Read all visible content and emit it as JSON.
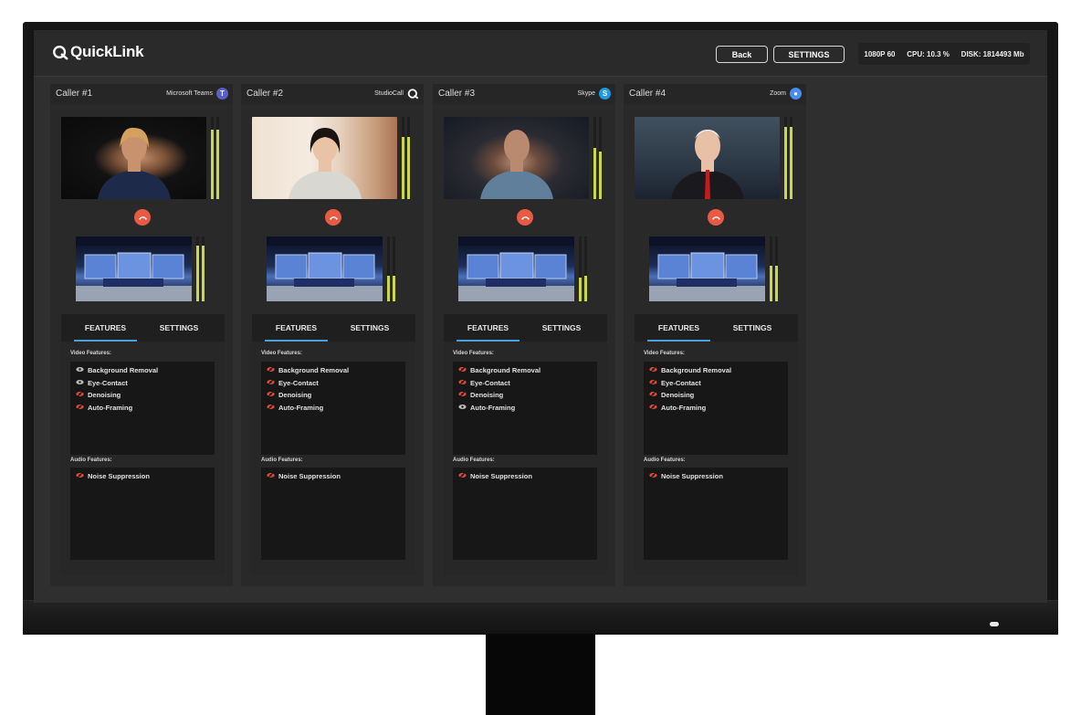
{
  "app": {
    "logo_text": "QuickLink",
    "back_label": "Back",
    "settings_label": "SETTINGS",
    "status": {
      "resolution": "1080P 60",
      "cpu": "CPU: 10.3 %",
      "disk": "DISK: 1814493 Mb"
    }
  },
  "callers": [
    {
      "title": "Caller #1",
      "platform": "Microsoft Teams",
      "platform_icon": "teams-icon",
      "platform_color": "#5b5fc7",
      "tabs": [
        "FEATURES",
        "SETTINGS"
      ],
      "video_label": "Video Features:",
      "audio_label": "Audio Features:",
      "video_features": [
        {
          "label": "Background Removal",
          "state": "on"
        },
        {
          "label": "Eye-Contact",
          "state": "on"
        },
        {
          "label": "Denoising",
          "state": "off"
        },
        {
          "label": "Auto-Framing",
          "state": "off"
        }
      ],
      "audio_features": [
        {
          "label": "Noise Suppression",
          "state": "off"
        }
      ]
    },
    {
      "title": "Caller #2",
      "platform": "StudioCall",
      "platform_icon": "studiocall-icon",
      "platform_color": "#ffffff",
      "tabs": [
        "FEATURES",
        "SETTINGS"
      ],
      "video_label": "Video Features:",
      "audio_label": "Audio Features:",
      "video_features": [
        {
          "label": "Background Removal",
          "state": "off"
        },
        {
          "label": "Eye-Contact",
          "state": "off"
        },
        {
          "label": "Denoising",
          "state": "off"
        },
        {
          "label": "Auto-Framing",
          "state": "off"
        }
      ],
      "audio_features": [
        {
          "label": "Noise Suppression",
          "state": "off"
        }
      ]
    },
    {
      "title": "Caller #3",
      "platform": "Skype",
      "platform_icon": "skype-icon",
      "platform_color": "#1e9be0",
      "tabs": [
        "FEATURES",
        "SETTINGS"
      ],
      "video_label": "Video Features:",
      "audio_label": "Audio Features:",
      "video_features": [
        {
          "label": "Background Removal",
          "state": "off"
        },
        {
          "label": "Eye-Contact",
          "state": "off"
        },
        {
          "label": "Denoising",
          "state": "off"
        },
        {
          "label": "Auto-Framing",
          "state": "on"
        }
      ],
      "audio_features": [
        {
          "label": "Noise Suppression",
          "state": "off"
        }
      ]
    },
    {
      "title": "Caller #4",
      "platform": "Zoom",
      "platform_icon": "zoom-icon",
      "platform_color": "#4a8df0",
      "tabs": [
        "FEATURES",
        "SETTINGS"
      ],
      "video_label": "Video Features:",
      "audio_label": "Audio Features:",
      "video_features": [
        {
          "label": "Background Removal",
          "state": "off"
        },
        {
          "label": "Eye-Contact",
          "state": "off"
        },
        {
          "label": "Denoising",
          "state": "off"
        },
        {
          "label": "Auto-Framing",
          "state": "off"
        }
      ],
      "audio_features": [
        {
          "label": "Noise Suppression",
          "state": "off"
        }
      ]
    }
  ],
  "colors": {
    "accent": "#4a9fd8",
    "hangup": "#e75b45",
    "meter": "#c8d84a",
    "feature_off": "#e04a3a",
    "feature_on": "#bcbcbc"
  }
}
